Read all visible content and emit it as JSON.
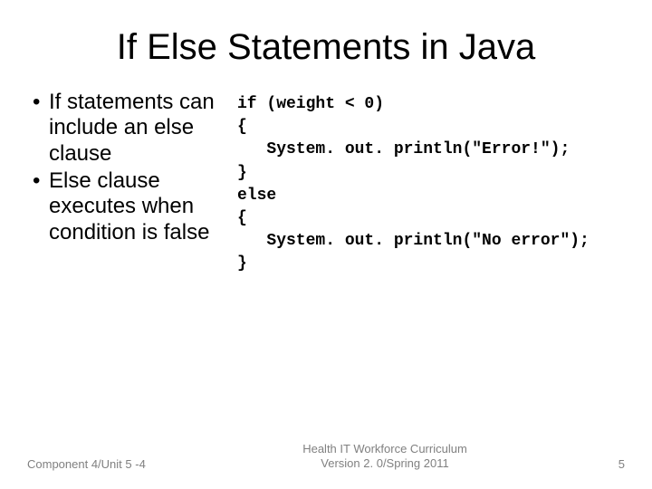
{
  "title": "If Else Statements in Java",
  "bullets": [
    "If statements can include an else clause",
    "Else clause executes when condition is false"
  ],
  "code": {
    "l1": "if (weight < 0)",
    "l2": "{",
    "l3": "   System. out. println(\"Error!\");",
    "l4": "}",
    "l5": "else",
    "l6": "{",
    "l7": "   System. out. println(\"No error\");",
    "l8": "}"
  },
  "footer": {
    "left": "Component 4/Unit 5 -4",
    "center_line1": "Health IT Workforce Curriculum",
    "center_line2": "Version 2. 0/Spring 2011",
    "right": "5"
  }
}
